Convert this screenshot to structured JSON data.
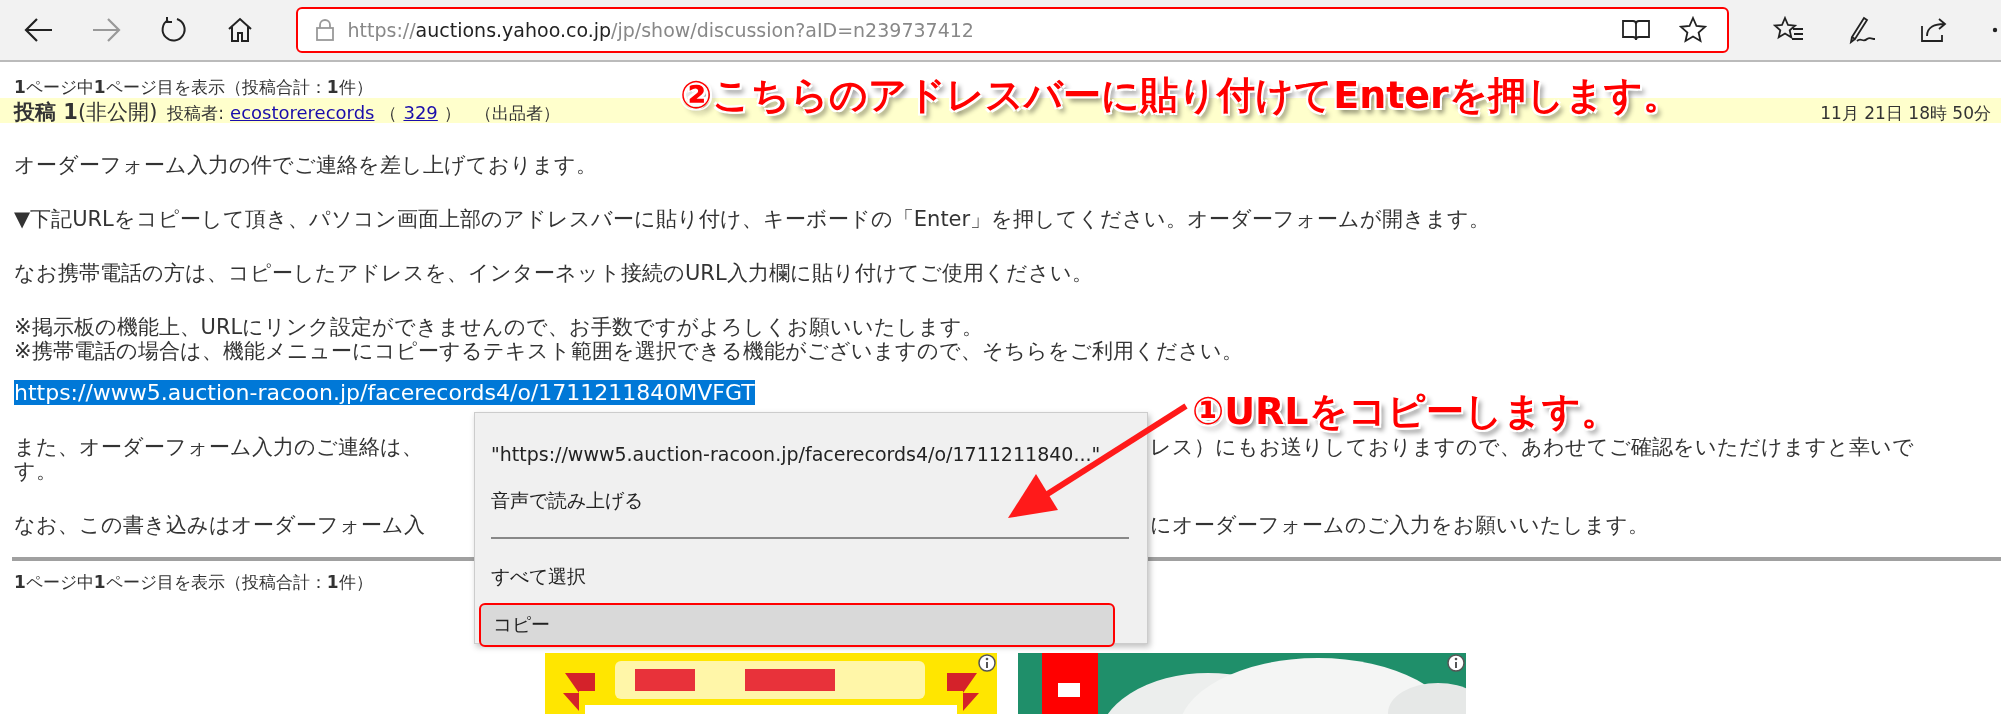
{
  "nav_buttons": [
    {
      "kind": "back",
      "disabled": false
    },
    {
      "kind": "forward",
      "disabled": true
    },
    {
      "kind": "refresh",
      "disabled": false
    },
    {
      "kind": "home",
      "disabled": false
    }
  ],
  "address_bar": {
    "scheme": "https://",
    "host": "auctions.yahoo.co.jp",
    "path": "/jp/show/discussion?aID=n239737412"
  },
  "toolbar_icons": [
    {
      "kind": "favorites"
    },
    {
      "kind": "pen"
    },
    {
      "kind": "share"
    },
    {
      "kind": "more"
    }
  ],
  "pager_top": "**1**ページ中**1**ページ目を表示（投稿合計：**1**件）",
  "post": {
    "title": "投稿 1",
    "visibility": "(非公開)",
    "author_label": "投稿者:",
    "author": "ecostorerecords",
    "rating_open": "（",
    "rating": "329",
    "rating_close": "）",
    "role": "（出品者）",
    "date": "11月 21日 18時 50分"
  },
  "blocks": [
    {
      "kind": "text",
      "lines": [
        "オーダーフォーム入力の件でご連絡を差し上げております。"
      ]
    },
    {
      "kind": "text",
      "lines": [
        "▼下記URLをコピーして頂き、パソコン画面上部のアドレスバーに貼り付け、キーボードの「Enter」を押してください。オーダーフォームが開きます。"
      ]
    },
    {
      "kind": "text",
      "lines": [
        "なお携帯電話の方は、コピーしたアドレスを、インターネット接続のURL入力欄に貼り付けてご使用ください。"
      ]
    },
    {
      "kind": "text",
      "lines": [
        "※掲示板の機能上、URLにリンク設定ができませんので、お手数ですがよろしくお願いいたします。",
        "※携帯電話の場合は、機能メニューにコピーするテキスト範囲を選択できる機能がございますので、そちらをご利用ください。"
      ]
    },
    {
      "kind": "selection",
      "lines": [
        "https://www5.auction-racoon.jp/facerecords4/o/1711211840MVFGT"
      ]
    },
    {
      "kind": "covered",
      "parts": [
        {
          "left": "また、オーダーフォーム入力のご連絡は、",
          "right": "レス）にもお送りしておりますので、あわせてご確認をいただけますと幸いで"
        },
        {
          "left": "す。"
        }
      ]
    },
    {
      "kind": "covered",
      "parts": [
        {
          "left": "なお、この書き込みはオーダーフォーム入",
          "right": "にオーダーフォームのご入力をお願いいたします。"
        }
      ]
    }
  ],
  "pager_bottom": "**1**ページ中**1**ページ目を表示（投稿合計：**1**件）",
  "context_menu": [
    {
      "kind": "item",
      "label": "\"https://www5.auction-racoon.jp/facerecords4/o/1711211840...\"",
      "selected": false
    },
    {
      "kind": "item",
      "label": "音声で読み上げる",
      "selected": false
    },
    {
      "kind": "separator"
    },
    {
      "kind": "item",
      "label": "すべて選択",
      "selected": false
    },
    {
      "kind": "item",
      "label": "コピー",
      "selected": true
    }
  ],
  "annotations": [
    {
      "kind": "address",
      "text": "②こちらのアドレスバーに貼り付けてEnterを押します。"
    },
    {
      "kind": "copy",
      "text": "①URLをコピーします。"
    }
  ]
}
